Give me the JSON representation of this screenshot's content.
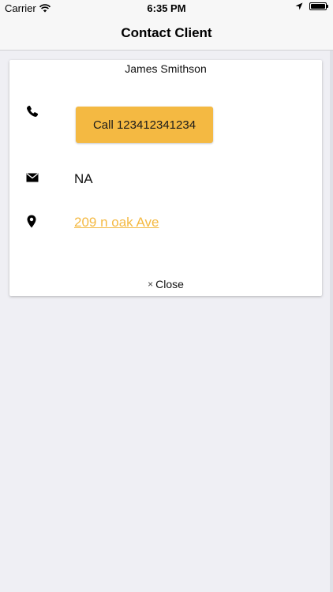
{
  "status_bar": {
    "carrier": "Carrier",
    "time": "6:35 PM",
    "icons": [
      "wifi-icon",
      "location-arrow-icon",
      "battery-icon"
    ],
    "battery_level": 1.0
  },
  "nav_bar": {
    "title": "Contact Client"
  },
  "card": {
    "client_name": "James Smithson",
    "phone": {
      "icon": "phone-icon",
      "button_label": "Call 123412341234"
    },
    "email": {
      "icon": "envelope-icon",
      "value": "NA"
    },
    "address": {
      "icon": "map-pin-icon",
      "value": "209 n oak Ave"
    },
    "close": {
      "icon": "close-icon",
      "icon_glyph": "×",
      "label": "Close"
    }
  },
  "colors": {
    "accent": "#f4b942",
    "background": "#efeff4",
    "card": "#ffffff"
  }
}
